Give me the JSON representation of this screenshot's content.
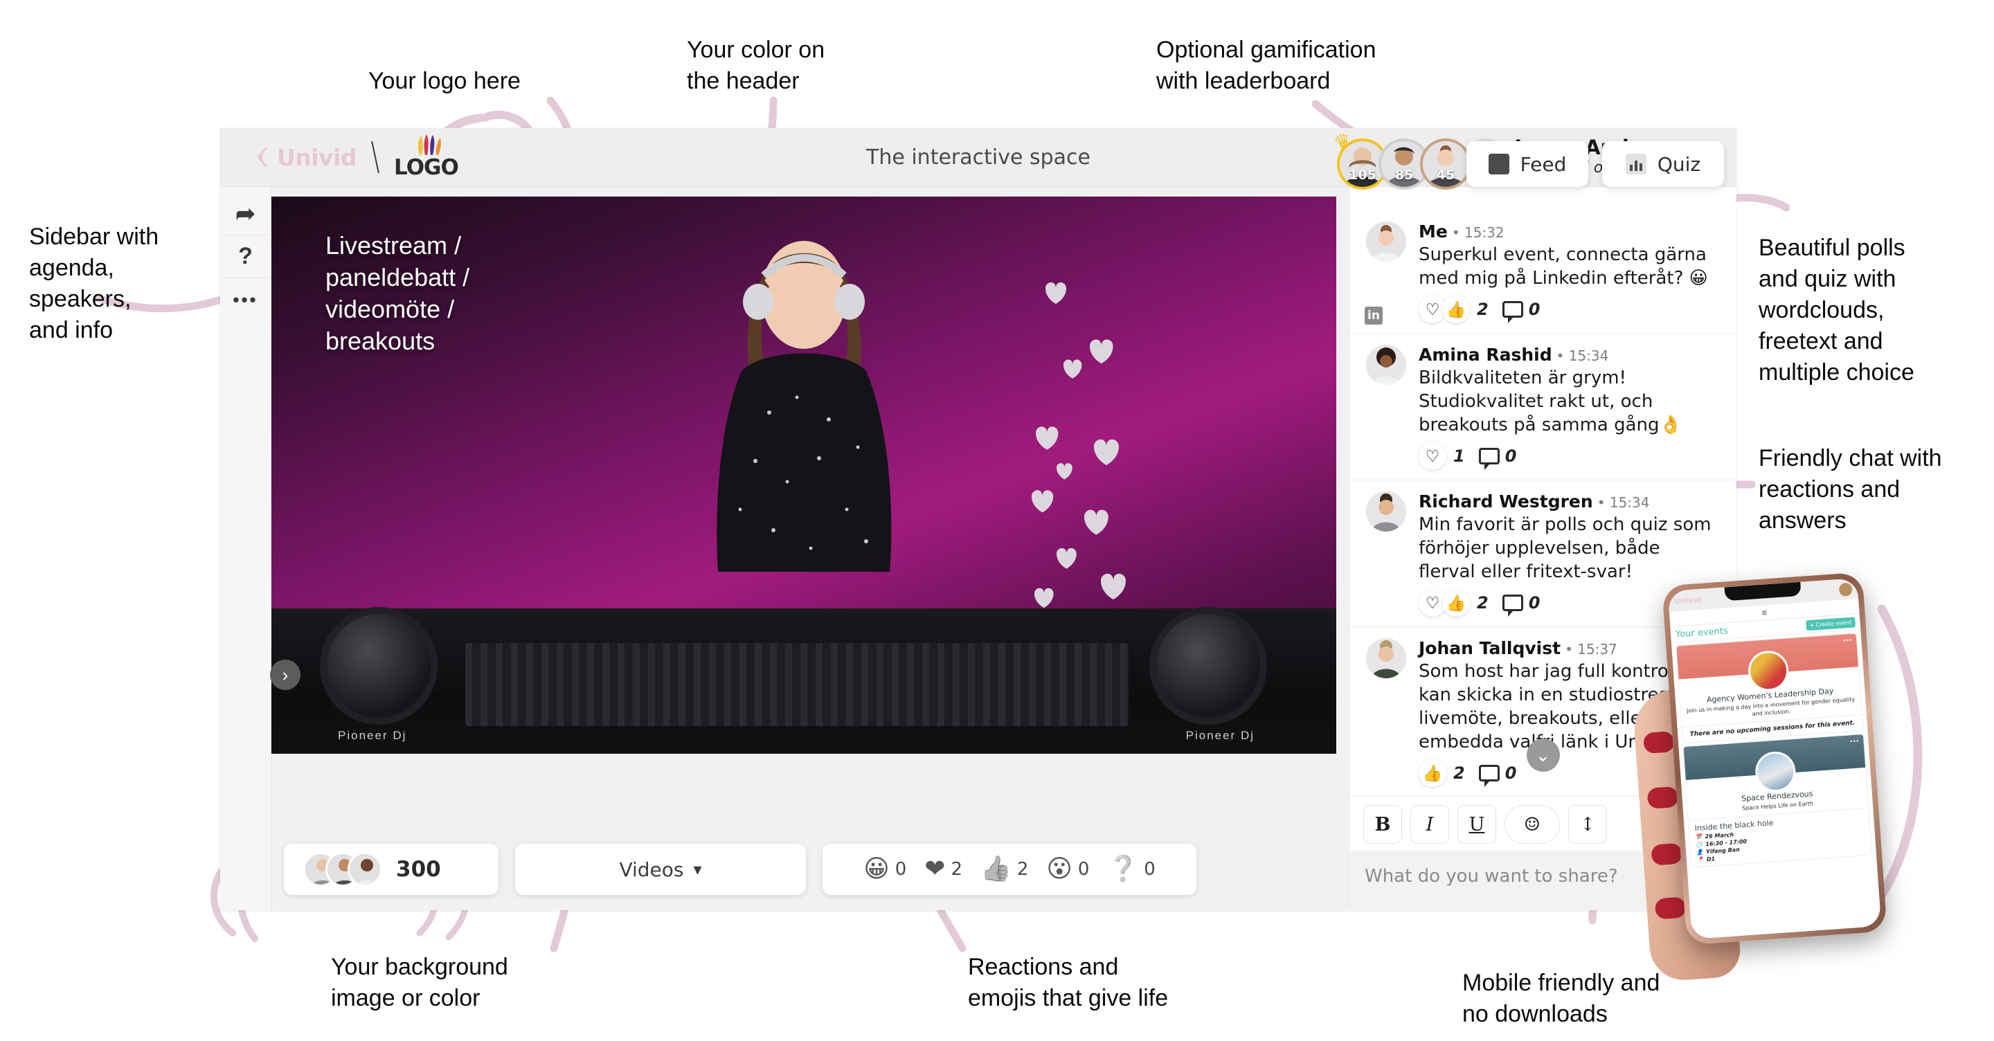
{
  "annotations": [
    {
      "id": "logo",
      "text": "Your logo here"
    },
    {
      "id": "headercolor",
      "text": "Your color on\nthe header"
    },
    {
      "id": "gamification",
      "text": "Optional gamification\nwith leaderboard"
    },
    {
      "id": "sidebar",
      "text": "Sidebar with\nagenda,\nspeakers,\nand info"
    },
    {
      "id": "polls",
      "text": "Beautiful polls\nand quiz with\nwordclouds,\nfreetext and\nmultiple choice"
    },
    {
      "id": "chat",
      "text": "Friendly chat with\nreactions and\nanswers"
    },
    {
      "id": "background",
      "text": "Your background\nimage or color"
    },
    {
      "id": "reactions",
      "text": "Reactions and\nemojis that give life"
    },
    {
      "id": "mobile",
      "text": "Mobile friendly and\nno downloads"
    }
  ],
  "header": {
    "brand": "Univid",
    "customer_logo": "LOGO",
    "title": "The interactive space",
    "user": {
      "name": "Jonna Andersson",
      "score": "45 (3rd of 5)",
      "crown_icon": "crown-icon"
    }
  },
  "rail": {
    "items": [
      {
        "icon": "share-icon",
        "glyph": "➦"
      },
      {
        "icon": "help-icon",
        "glyph": "?"
      },
      {
        "icon": "more-icon",
        "glyph": "•••"
      }
    ],
    "expand_glyph": "›"
  },
  "stage": {
    "video_label": "Livestream /\npaneldebatt /\nvideomöte /\nbreakouts",
    "deck_brand": "Pioneer Dj",
    "viewers_count": "300",
    "videos_label": "Videos",
    "videos_caret": "⌄",
    "reactions": [
      {
        "name": "laugh-reaction",
        "glyph": "😀",
        "count": "0"
      },
      {
        "name": "heart-reaction",
        "glyph": "❤",
        "count": "2"
      },
      {
        "name": "thumbsup-reaction",
        "glyph": "👍",
        "count": "2"
      },
      {
        "name": "wow-reaction",
        "glyph": "😮",
        "count": "0"
      },
      {
        "name": "question-reaction",
        "glyph": "❔",
        "count": "0"
      }
    ]
  },
  "leaderboard": [
    {
      "score": "105",
      "rank": 1,
      "crown": "♛"
    },
    {
      "score": "85",
      "rank": 2
    },
    {
      "score": "45",
      "rank": 3
    }
  ],
  "tabs": [
    {
      "label": "Feed",
      "icon": "feed-icon",
      "active": true
    },
    {
      "label": "Quiz",
      "icon": "quiz-icon",
      "active": false
    }
  ],
  "chat": {
    "messages": [
      {
        "name": "Me",
        "time": "15:32",
        "badge": "in",
        "text": "Superkul event, connecta gärna med mig på Linkedin efteråt? 😀",
        "heart": true,
        "thumb": true,
        "likes": "2",
        "comments": "0"
      },
      {
        "name": "Amina Rashid",
        "time": "15:34",
        "text": "Bildkvaliteten är grym! Studiokvalitet rakt ut, och breakouts på samma gång👌",
        "heart": true,
        "thumb": false,
        "likes": "1",
        "comments": "0"
      },
      {
        "name": "Richard Westgren",
        "time": "15:34",
        "text": "Min favorit är polls och quiz som förhöjer upplevelsen, både flerval eller fritext-svar!",
        "heart": true,
        "thumb": true,
        "likes": "2",
        "comments": "0"
      },
      {
        "name": "Johan Tallqvist",
        "time": "15:37",
        "text": "Som host har jag full kontroll och kan skicka in en studiostream, ha livemöte, breakouts, eller embedda valfri länk i Univid. 🚀",
        "heart": false,
        "thumb": true,
        "likes": "2",
        "comments": "0"
      }
    ],
    "scroll_down_glyph": "⌄",
    "composer": {
      "bold": "B",
      "italic": "I",
      "underline": "U",
      "emoji": "☺",
      "more": "↕",
      "placeholder": "What do you want to share?"
    }
  },
  "phone": {
    "brand": "Univid",
    "menu_glyph": "≡",
    "events_title": "Your events",
    "create_button": "+ Create event",
    "cards": [
      {
        "title": "Agency Women's Leadership Day",
        "subtitle": "Join us in making a day into a movement for gender equality and inclusion.",
        "note": "There are no upcoming sessions for this event."
      },
      {
        "title": "Space Rendezvous",
        "subtitle": "Space Helps Life on Earth",
        "session_title": "Inside the black hole",
        "meta": [
          {
            "icon": "calendar-icon",
            "glyph": "📅",
            "text": "26 March"
          },
          {
            "icon": "clock-icon",
            "glyph": "🕒",
            "text": "16:30 - 17:00"
          },
          {
            "icon": "person-icon",
            "glyph": "👤",
            "text": "Yifang Ban"
          },
          {
            "icon": "pin-icon",
            "glyph": "📍",
            "text": "D1"
          }
        ]
      }
    ]
  },
  "colors": {
    "annotation_arrow": "#e3cad7",
    "brand_pink": "#e6c7d6",
    "app_bg": "#f1f0f2",
    "header_bg": "#efeeee",
    "gold": "#f0c420"
  }
}
